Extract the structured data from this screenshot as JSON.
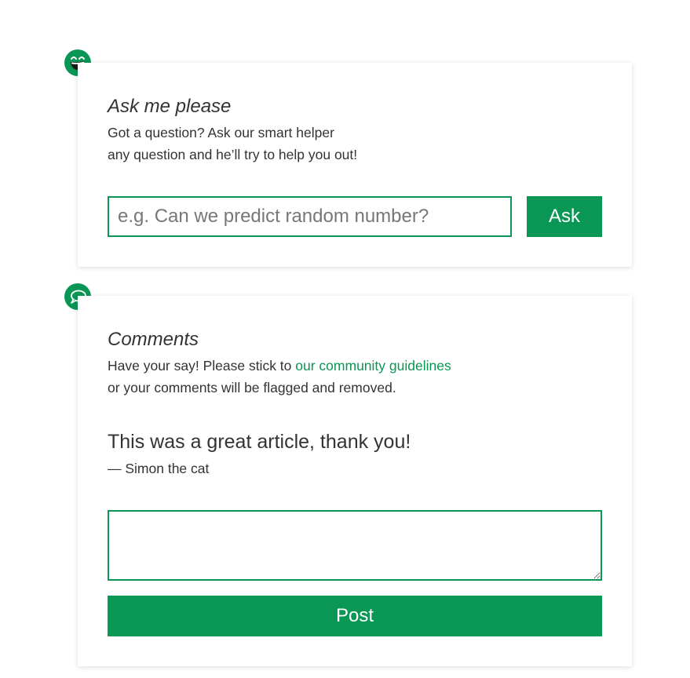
{
  "ask": {
    "badge_icon": "laughing-face-icon",
    "title": "Ask me please",
    "text_line1": "Got a question? Ask our smart helper",
    "text_line2": "any question and he’ll try to help you out!",
    "input_placeholder": "e.g. Can we predict random number?",
    "input_value": "",
    "button_label": "Ask"
  },
  "comments": {
    "badge_icon": "speech-bubble-icon",
    "title": "Comments",
    "text_prefix": "Have your say! Please stick to ",
    "guidelines_link": "our community guidelines",
    "text_line2": "or your comments will be flagged and removed.",
    "quote": "This was a great article, thank you!",
    "author": "— Simon the cat",
    "textarea_value": "",
    "post_label": "Post"
  },
  "colors": {
    "accent": "#0a9654",
    "text": "#333333",
    "placeholder": "#777777",
    "background": "#ffffff"
  }
}
